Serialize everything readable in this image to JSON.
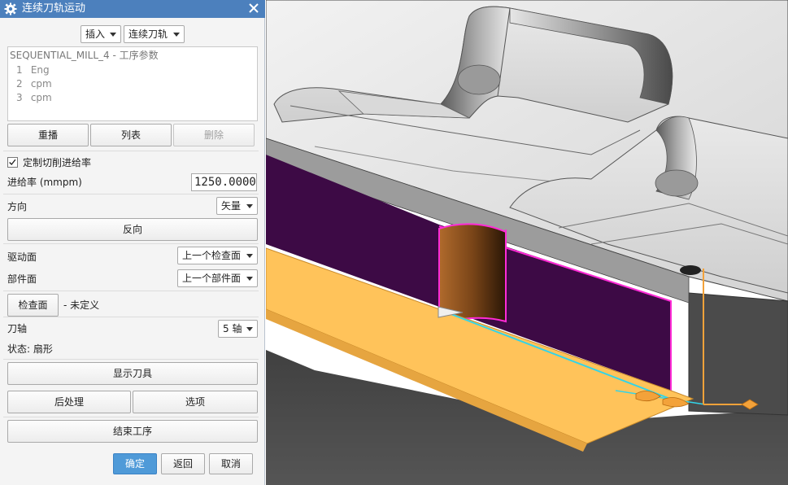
{
  "dialog": {
    "title": "连续刀轨运动",
    "insert_mode": "插入",
    "motion_type": "连续刀轨",
    "operation_list": {
      "header": "SEQUENTIAL_MILL_4 - 工序参数",
      "rows": [
        {
          "num": "1",
          "text": "Eng"
        },
        {
          "num": "2",
          "text": "cpm"
        },
        {
          "num": "3",
          "text": "cpm"
        }
      ]
    },
    "replay_label": "重播",
    "list_label": "列表",
    "delete_label": "删除",
    "custom_feed_label": "定制切削进给率",
    "custom_feed_checked": true,
    "feed_rate_label": "进给率 (mmpm)",
    "feed_rate_value": "1250.0000",
    "direction_label": "方向",
    "direction_value": "矢量",
    "reverse_label": "反向",
    "drive_surface_label": "驱动面",
    "drive_surface_value": "上一个检查面",
    "part_surface_label": "部件面",
    "part_surface_value": "上一个部件面",
    "check_surface_label": "检查面",
    "check_surface_status": "- 未定义",
    "tool_axis_label": "刀轴",
    "tool_axis_value": "5 轴",
    "status_label": "状态: 扇形",
    "show_tool_label": "显示刀具",
    "postprocess_label": "后处理",
    "options_label": "选项",
    "end_operation_label": "结束工序",
    "ok_label": "确定",
    "back_label": "返回",
    "cancel_label": "取消"
  },
  "icons": {
    "title_icon": "gear-icon",
    "close_icon": "close-icon",
    "dropdown_icon": "chevron-down-icon",
    "checkbox_icon": "checkmark-icon"
  },
  "colors": {
    "title_bar": "#4c80bd",
    "ok_button": "#4f9ad8",
    "drive_wall": "#3d0a45",
    "highlight_edge": "#ff2bd6",
    "floor_surface": "#ffc35a",
    "tool_path": "#33d4e8",
    "axis_arrow": "#f3a23a",
    "part_gray": "#6f6f6f"
  }
}
